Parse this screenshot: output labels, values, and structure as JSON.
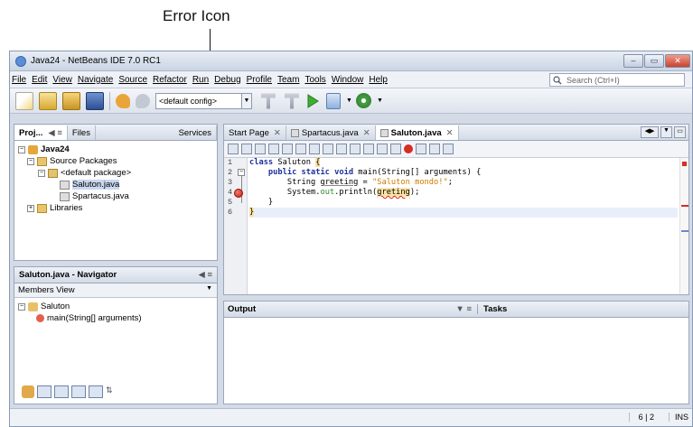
{
  "annotation": {
    "label": "Error Icon"
  },
  "window": {
    "title": "Java24 - NetBeans IDE 7.0 RC1",
    "btn_min": "–",
    "btn_max": "▭",
    "btn_close": "✕"
  },
  "menubar": {
    "items": [
      "File",
      "Edit",
      "View",
      "Navigate",
      "Source",
      "Refactor",
      "Run",
      "Debug",
      "Profile",
      "Team",
      "Tools",
      "Window",
      "Help"
    ],
    "search_placeholder": "Search (Ctrl+I)"
  },
  "toolbar": {
    "config_value": "<default config>"
  },
  "projects": {
    "tabs": [
      "Proj...",
      "Files",
      "Services"
    ],
    "tree": [
      "Java24",
      "Source Packages",
      "<default package>",
      "Saluton.java",
      "Spartacus.java",
      "Libraries"
    ]
  },
  "navigator": {
    "title": "Saluton.java - Navigator",
    "view": "Members View",
    "class": "Saluton",
    "member": "main(String[] arguments)"
  },
  "editor": {
    "tabs": [
      "Start Page",
      "Spartacus.java",
      "Saluton.java"
    ],
    "line_numbers": [
      "1",
      "2",
      "3",
      "4",
      "5",
      "6"
    ],
    "code": {
      "l1_kw": "class",
      "l1_name": " Saluton ",
      "l1_brace": "{",
      "l2_mods": "public static void",
      "l2_rest": " main(String[] arguments) {",
      "l3_a": "String ",
      "l3_var": "greeting",
      "l3_b": " = ",
      "l3_str": "\"Saluton mondo!\"",
      "l3_c": ";",
      "l4_a": "System.",
      "l4_out": "out",
      "l4_b": ".println(",
      "l4_err": "greting",
      "l4_c": ");",
      "l5": "}",
      "l6": "}"
    }
  },
  "output": {
    "title": "Output",
    "tasks": "Tasks"
  },
  "status": {
    "position": "6 | 2",
    "mode": "INS"
  }
}
